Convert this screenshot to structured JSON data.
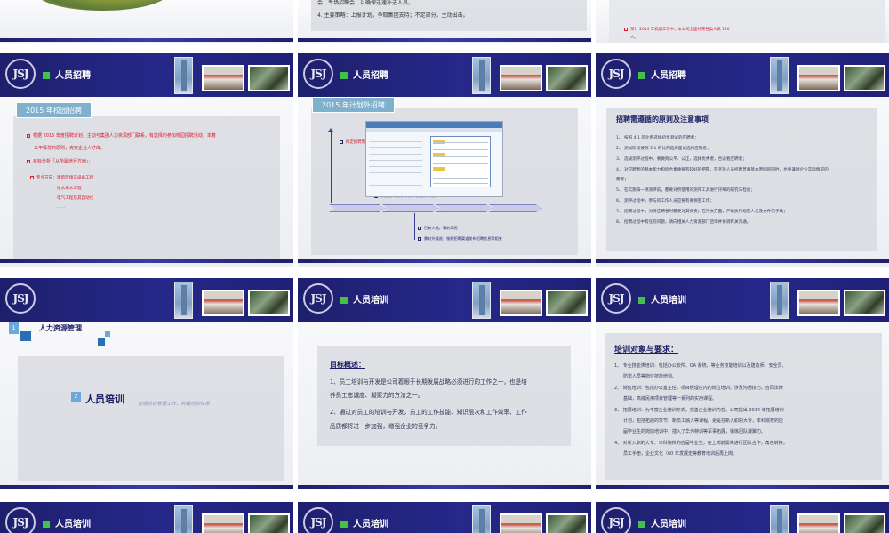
{
  "header": {
    "logo": "JSJ",
    "recruit_title": "人员招聘",
    "training_title": "人员培训"
  },
  "top_row": {
    "middle_line1": "会，专场招聘会，以确保迅速补进人员。",
    "middle_line2": "4. 主要策略：上报计划，争取集团支持；不足部分，主动出击。",
    "right_line1": "预计 2014 年机组工作中，本公司全面补充各类人员",
    "right_line2": "人。"
  },
  "campus": {
    "tag": "2015 年校园招聘",
    "line1": "根据 2015 年度招聘计划，主动与集团人力资源部门联系，有选择的参加校园招聘活动，本着",
    "line2": "公平择优的原则，充实企业人才库。",
    "line3": "目标分析「从所属途径方面」：",
    "line4": "专业方向：建筑环境与设备工程",
    "line5": "给水排水工程",
    "line6": "电气工程及其自动化",
    "line7": "……"
  },
  "social": {
    "tag": "2015 年计划外招聘",
    "note_top": "拟定招聘需求",
    "note_mid": "依据招聘需求申请，按程序审批",
    "note_b1": "已有人选，请转简历",
    "note_b2": "需对外搜选：按照招聘渠道发布招聘信息等相关"
  },
  "principles": {
    "heading": "招聘需遵循的原则及注意事项",
    "items": [
      "1、 按照 4:1 的比例选择初步测试的应聘者；",
      "2、 测试阶段按照 3:1 的比例选择面试选择应聘者；",
      "3、 选拔测评过程中，要做到公平、公正，选择优秀者，合适者应聘者；",
      "4、 对应聘者的基本能力和综合素质要有较好的把握，在坚持人员招聘普遍基本原则的同时，也要兼顾企业实际情况的",
      "需要；",
      "5、 在实施每一项测评前，都要对所使用的测评工具进行仔细的研究与检验；",
      "6、 测评过程中，参与的工作人员应要有要保密工作；",
      "7、 招聘过程中，对待应聘者时都要对其负责；在行文方面，严格执行规范人员及文件的手续；",
      "8、 招聘过程中有任何问题，请向相关人力资源部门咨询并协调有关沟通。"
    ]
  },
  "section_slide": {
    "num1": "1",
    "item1": "人力资源管理",
    "num2": "2",
    "item2": "人员培训",
    "subtitle": "加强培训管理工作，构建培训体系"
  },
  "goals": {
    "heading": "目标概述：",
    "p1a": "1、员工培训与开发是公司着眼于长期发展战略必须进行的工作之一，也是培",
    "p1b": "养员工忠诚度、凝聚力的方法之一。",
    "p2a": "2、通过对员工的培训与开发，员工的工作技能、知识层次和工作效率、工作",
    "p2b": "品质都将进一步加强，增强企业的竞争力。"
  },
  "targets": {
    "heading": "培训对象与要求：",
    "items": [
      "1、 专业技能类培训：包括办公软件、OA 系统、等业务技能培训以及建造师、安全员、",
      "防雷人员等岗位技能培训。",
      "2、 岗位培训：包括办公室主任，项目经理在内的岗位培训，涉及沟通技巧，合同法律",
      "基础，高级民用项目管理等一系列的实用课程。",
      "3、 拓展培训：为丰富企业培训形式，完善企业培训内容，公司提出 2014 年拓展培训",
      "计划，包括拓展的季节，新员工融入等课程。更是在新入职的大专，本科院校的应",
      "届毕业生的岗前培训中，插入了华为特训等军事拓展，锻炼团队凝聚力。",
      "4、 对新入职的大专、本科院校的应届毕业生，在上岗前需先进行团队合作，角色转换，",
      "员工手册，企业文化（60 年发展史等教育培训后再上岗。"
    ]
  },
  "colors": {
    "header_navy": "#23257e",
    "accent_green": "#43c14a",
    "text_red": "#d8182c",
    "tag_blue": "#7fb0cc"
  },
  "icons": [
    "logo-jsj",
    "green-square-icon",
    "building-photo",
    "meeting-photo",
    "outdoor-photo"
  ]
}
